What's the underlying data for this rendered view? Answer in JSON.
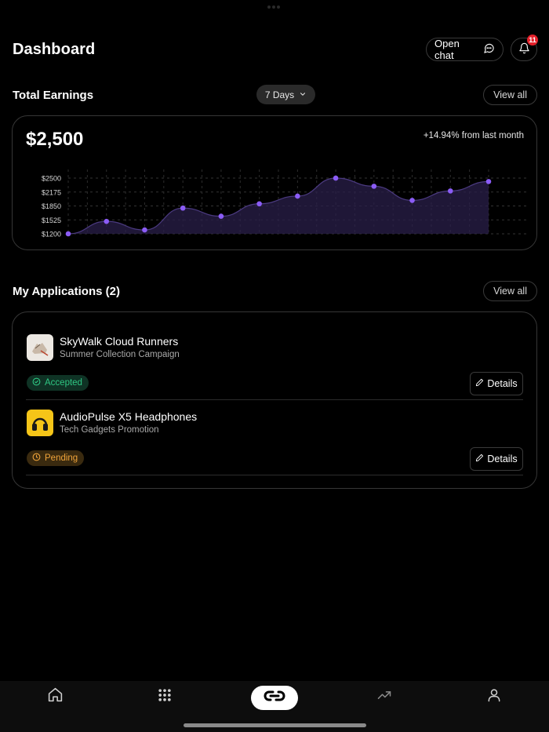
{
  "header": {
    "title": "Dashboard",
    "open_chat_label": "Open chat",
    "notification_count": "11"
  },
  "earnings": {
    "section_title": "Total Earnings",
    "range_label": "7 Days",
    "view_all_label": "View all",
    "amount": "$2,500",
    "change": "+14.94% from last month"
  },
  "chart_data": {
    "type": "area",
    "y_ticks": [
      "$2500",
      "$2175",
      "$1850",
      "$1525",
      "$1200"
    ],
    "ylim": [
      1200,
      2500
    ],
    "grid": true,
    "accent_color": "#8b5cf6",
    "values": [
      1200,
      1490,
      1290,
      1800,
      1610,
      1900,
      2080,
      2500,
      2310,
      1980,
      2200,
      2420
    ]
  },
  "applications": {
    "section_title": "My Applications (2)",
    "view_all_label": "View all",
    "items": [
      {
        "name": "SkyWalk Cloud Runners",
        "subtitle": "Summer Collection Campaign",
        "status": "Accepted",
        "status_icon": "check-circle-icon",
        "details_label": "Details"
      },
      {
        "name": "AudioPulse X5 Headphones",
        "subtitle": "Tech Gadgets Promotion",
        "status": "Pending",
        "status_icon": "clock-icon",
        "details_label": "Details"
      }
    ]
  },
  "tabbar": {
    "tabs": [
      "home-icon",
      "grid-icon",
      "link-icon",
      "trending-icon",
      "profile-icon"
    ],
    "active": "link-icon"
  }
}
